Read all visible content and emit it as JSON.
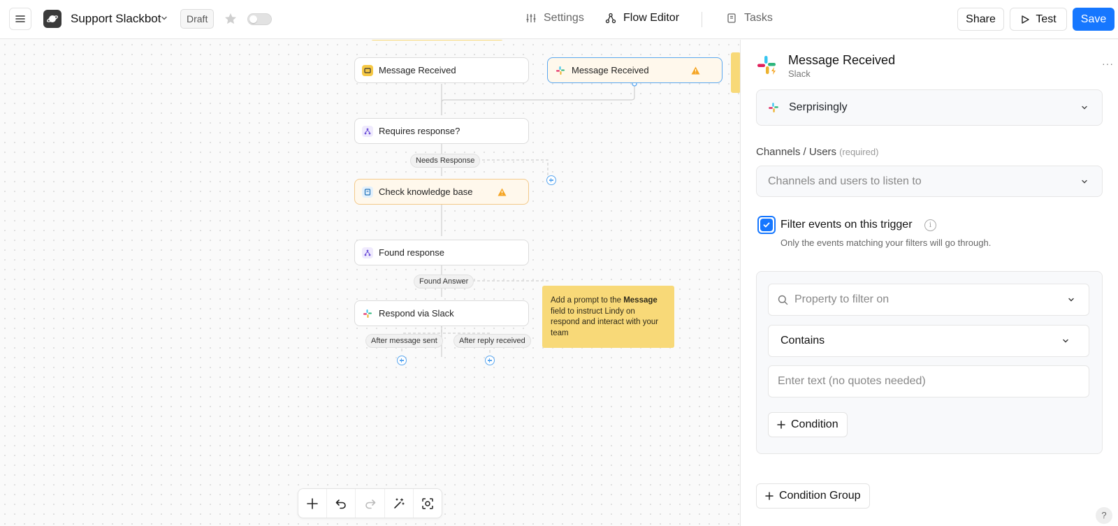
{
  "header": {
    "app_title": "Support Slackbot",
    "status_badge": "Draft",
    "tabs": [
      {
        "label": "Settings",
        "icon": "sliders-icon"
      },
      {
        "label": "Flow Editor",
        "icon": "flow-icon"
      },
      {
        "label": "Tasks",
        "icon": "book-icon"
      }
    ],
    "active_tab": "Flow Editor",
    "share_label": "Share",
    "test_label": "Test",
    "save_label": "Save",
    "accent_color": "#1677ff"
  },
  "canvas": {
    "nodes": [
      {
        "label": "Message Received",
        "icon": "trigger-icon"
      },
      {
        "label": "Message Received",
        "icon": "slack-icon",
        "warning": true,
        "selected": true
      },
      {
        "label": "Requires response?",
        "icon": "condition-icon"
      },
      {
        "label": "Check knowledge base",
        "icon": "knowledge-icon",
        "warning": true
      },
      {
        "label": "Found response",
        "icon": "condition-icon"
      },
      {
        "label": "Respond via Slack",
        "icon": "slack-icon"
      }
    ],
    "branch_labels": [
      "Needs Response",
      "Found Answer",
      "After message sent",
      "After reply received"
    ],
    "sticky_note": {
      "before": "Add a prompt to the ",
      "bold": "Message",
      "after": " field to instruct Lindy on respond and interact with your team"
    },
    "toolbar": [
      "add-icon",
      "undo-icon",
      "redo-icon",
      "magic-icon",
      "focus-icon"
    ]
  },
  "panel": {
    "title": "Message Received",
    "subtitle": "Slack",
    "more": "···",
    "account": "Serprisingly",
    "channels_label": "Channels / Users",
    "channels_required": "(required)",
    "channels_placeholder": "Channels and users to listen to",
    "filter_checkbox_label": "Filter events on this trigger",
    "filter_checked": true,
    "filter_help": "Only the events matching your filters will go through.",
    "property_placeholder": "Property to filter on",
    "operator": "Contains",
    "value_placeholder": "Enter text (no quotes needed)",
    "add_condition": "Condition",
    "add_condition_group": "Condition Group"
  },
  "help_label": "?"
}
